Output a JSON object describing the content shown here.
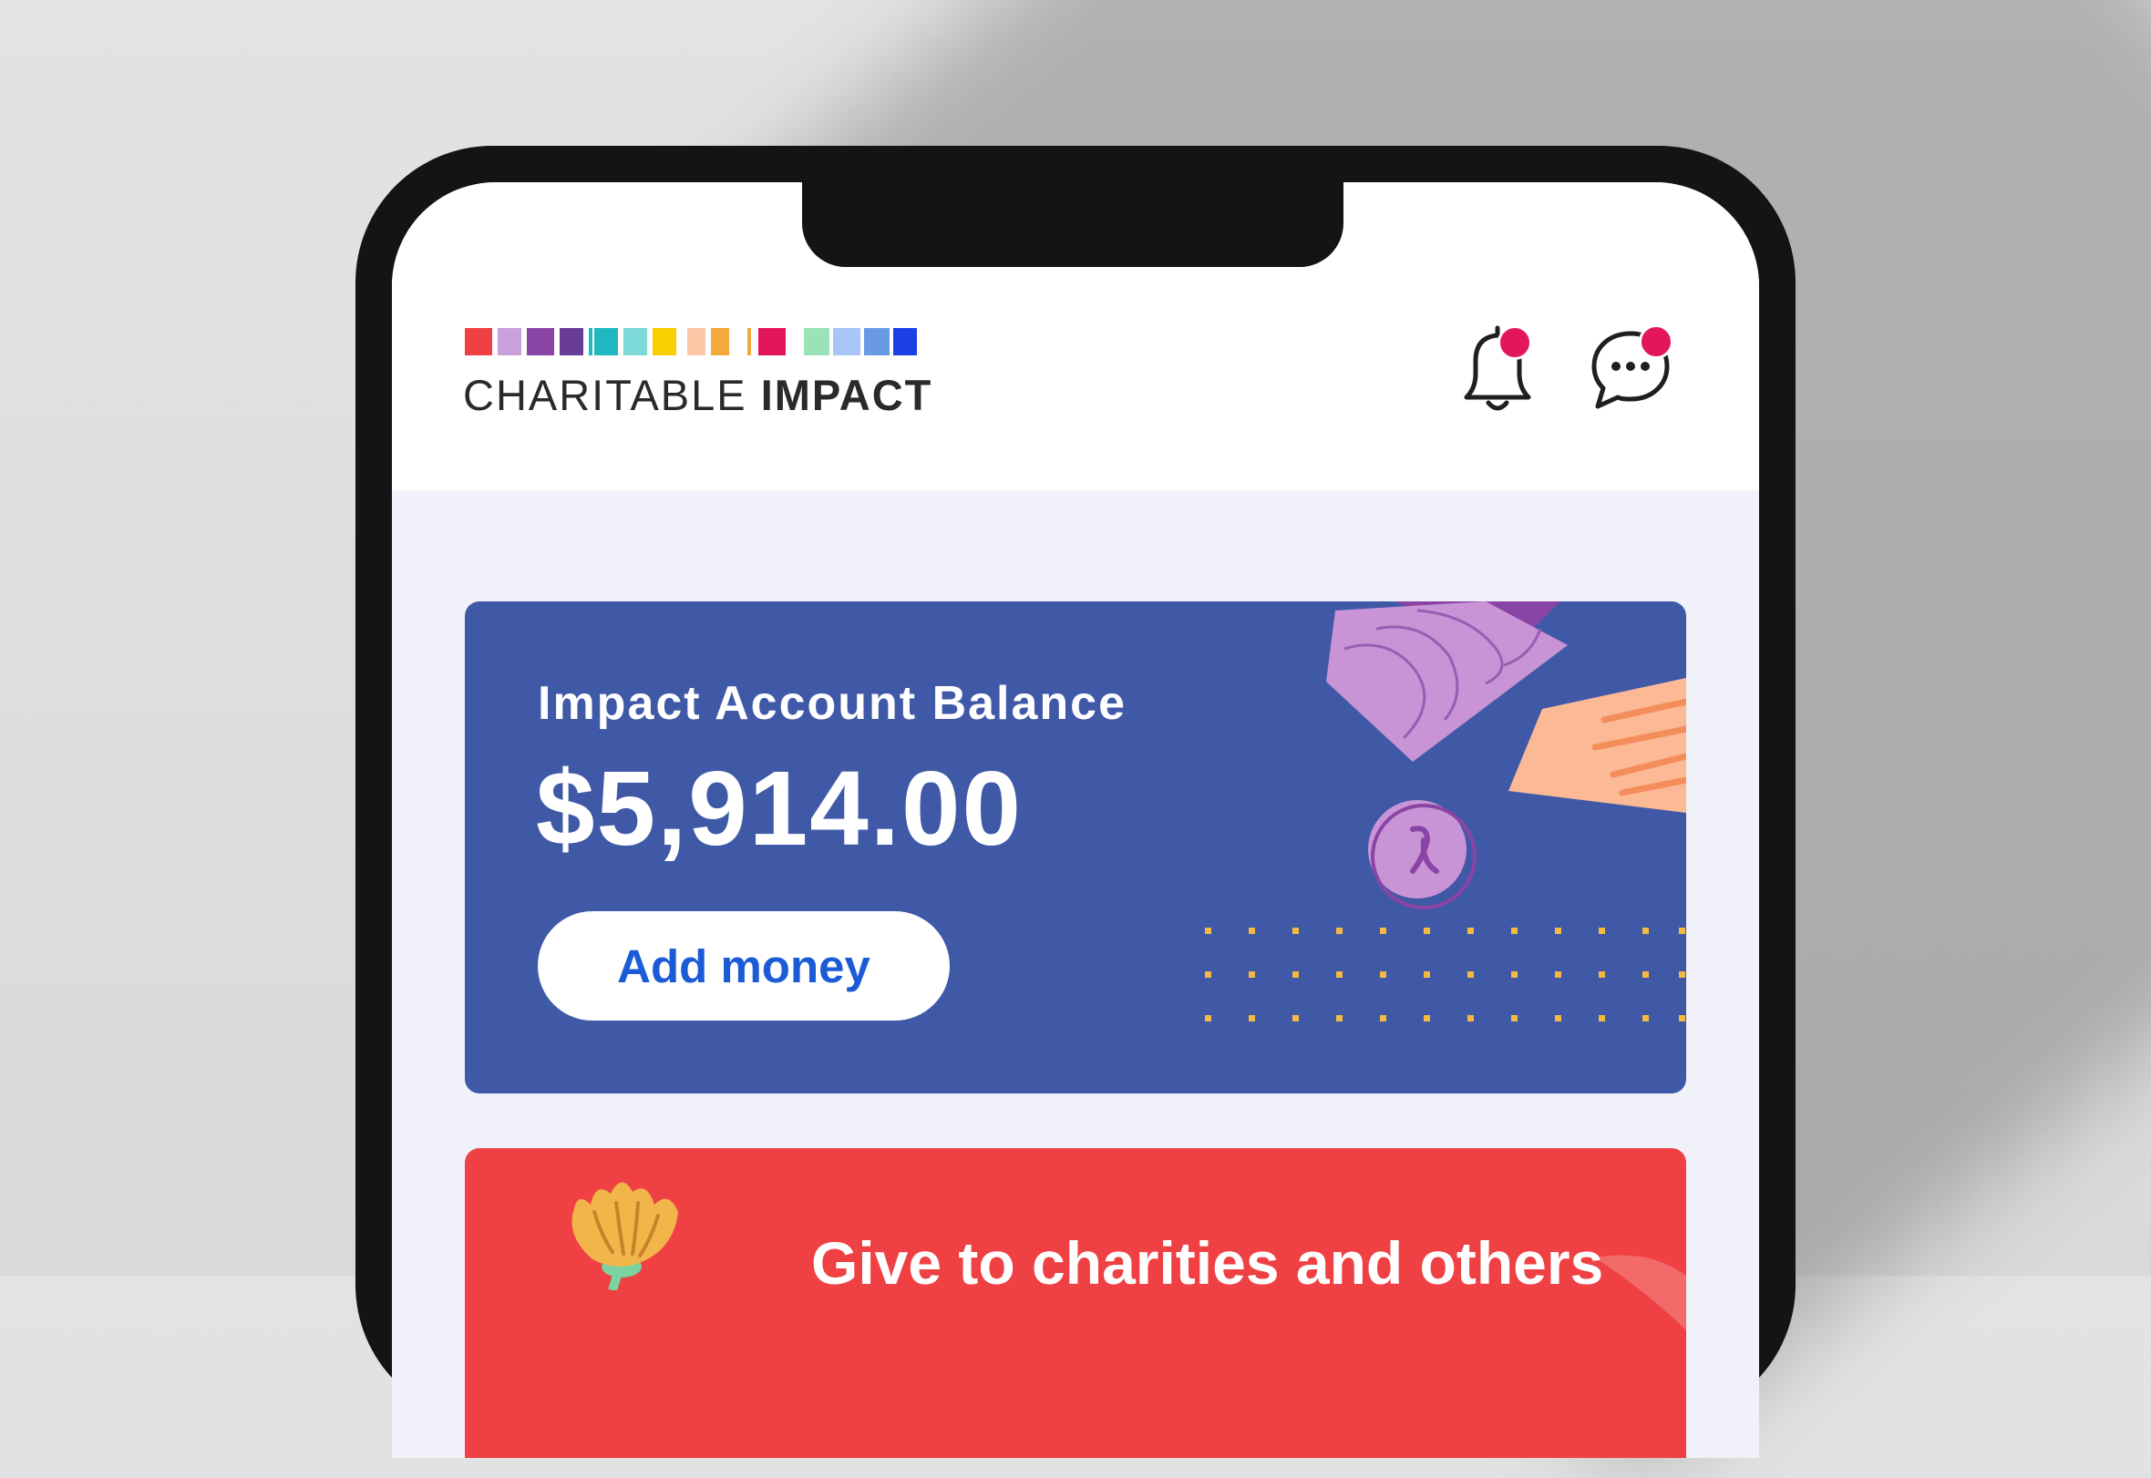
{
  "brand": {
    "name_light": "CHARITABLE",
    "name_bold": "IMPACT",
    "strip_colors": [
      "#ef4143",
      "#c9a0dc",
      "#8a44a6",
      "#6a3d95",
      "#1fb7c0",
      "#7dd9d7",
      "#f7d000",
      "#fcc6a6",
      "#f4a93b",
      "#f4a93b",
      "#e3165b",
      "#9be3b6",
      "#a7c6f5",
      "#6a9ae6",
      "#1a3fe6"
    ]
  },
  "header": {
    "notifications_icon": "bell-icon",
    "messages_icon": "chat-bubble-icon",
    "badge_color": "#e3165b"
  },
  "balance_card": {
    "title": "Impact Account Balance",
    "amount": "$5,914.00",
    "add_money_label": "Add money",
    "background": "#4059a7",
    "button_text_color": "#1b5bd6"
  },
  "give_card": {
    "title": "Give to charities and others",
    "background": "#ef4143"
  }
}
